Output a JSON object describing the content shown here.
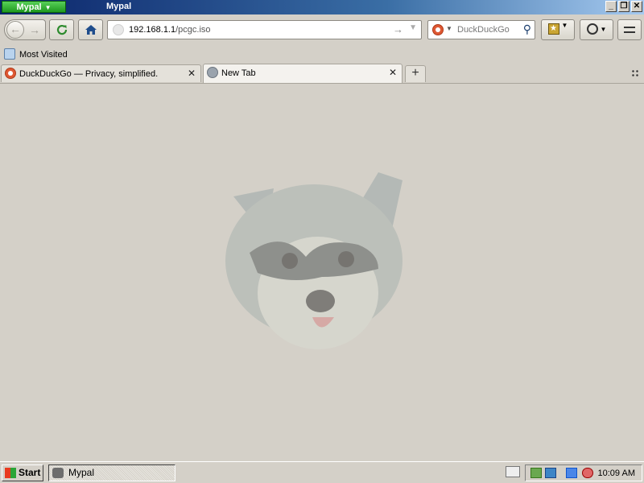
{
  "window": {
    "app_menu_label": "Mypal",
    "title": "Mypal",
    "controls": [
      "minimize",
      "restore",
      "close"
    ]
  },
  "navbar": {
    "url_host": "192.168.1.1",
    "url_path": "/pcgc.iso",
    "search_placeholder": "DuckDuckGo",
    "icons": [
      "back-icon",
      "forward-icon",
      "reload-icon",
      "home-icon",
      "bookmarks-icon",
      "history-icon",
      "menu-icon"
    ]
  },
  "bookmarks_bar": {
    "items": [
      {
        "label": "Most Visited"
      }
    ]
  },
  "tabs": [
    {
      "label": "DuckDuckGo — Privacy, simplified.",
      "active": false
    },
    {
      "label": "New Tab",
      "active": true
    }
  ],
  "content": {
    "background_color": "#d4d0c8"
  },
  "taskbar": {
    "start_label": "Start",
    "task_label": "Mypal",
    "clock": "10:09 AM"
  }
}
